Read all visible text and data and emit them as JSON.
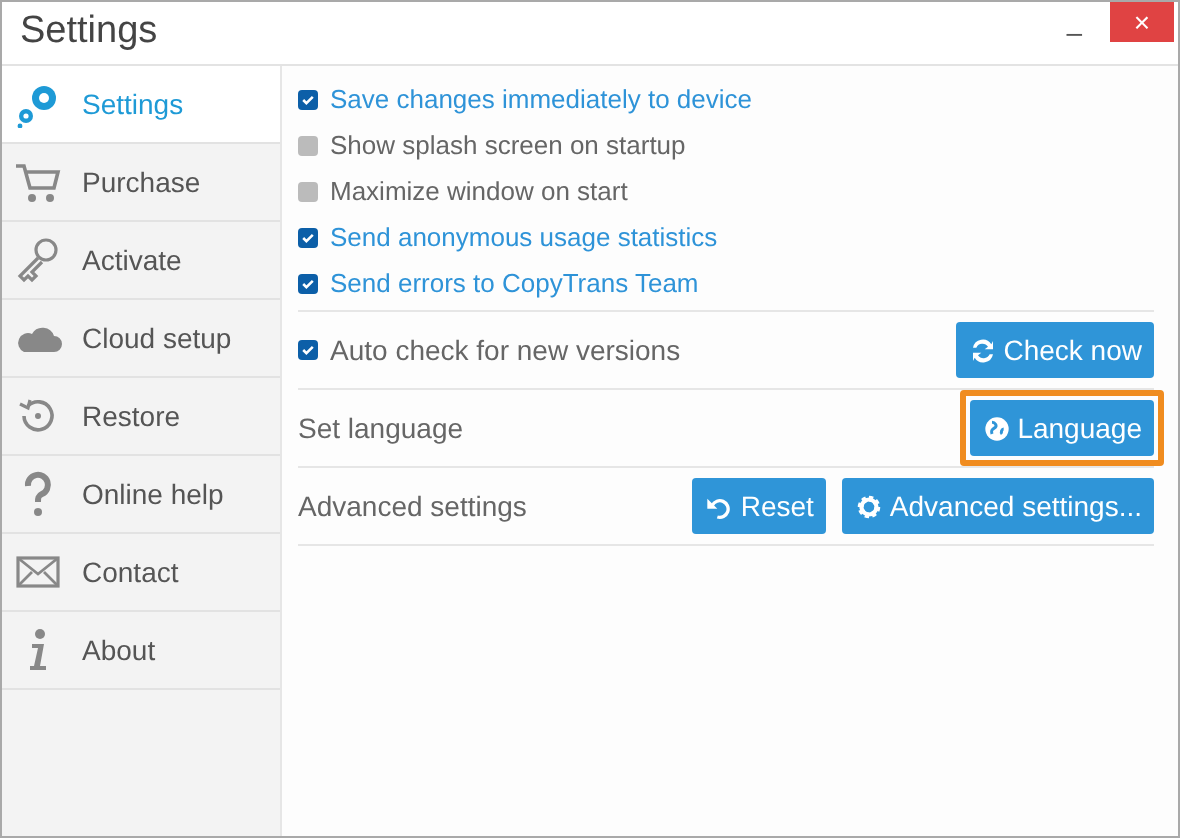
{
  "window": {
    "title": "Settings",
    "minimize": "–",
    "close": "×"
  },
  "sidebar": {
    "items": [
      {
        "label": "Settings",
        "selected": true
      },
      {
        "label": "Purchase",
        "selected": false
      },
      {
        "label": "Activate",
        "selected": false
      },
      {
        "label": "Cloud setup",
        "selected": false
      },
      {
        "label": "Restore",
        "selected": false
      },
      {
        "label": "Online help",
        "selected": false
      },
      {
        "label": "Contact",
        "selected": false
      },
      {
        "label": "About",
        "selected": false
      }
    ]
  },
  "options": [
    {
      "label": "Save changes immediately to device",
      "checked": true
    },
    {
      "label": "Show splash screen on startup",
      "checked": false
    },
    {
      "label": "Maximize window on start",
      "checked": false
    },
    {
      "label": "Send anonymous usage statistics",
      "checked": true
    },
    {
      "label": "Send errors to CopyTrans Team",
      "checked": true
    }
  ],
  "rows": [
    {
      "kind": "checkbox",
      "label": "Auto check for new versions",
      "checked": true,
      "buttons": [
        {
          "label": "Check now",
          "highlighted": false
        }
      ]
    },
    {
      "kind": "text",
      "label": "Set language",
      "buttons": [
        {
          "label": "Language",
          "highlighted": true
        }
      ]
    },
    {
      "kind": "text",
      "label": "Advanced settings",
      "buttons": [
        {
          "label": "Reset",
          "highlighted": false
        },
        {
          "label": "Advanced settings...",
          "highlighted": false
        }
      ]
    }
  ]
}
